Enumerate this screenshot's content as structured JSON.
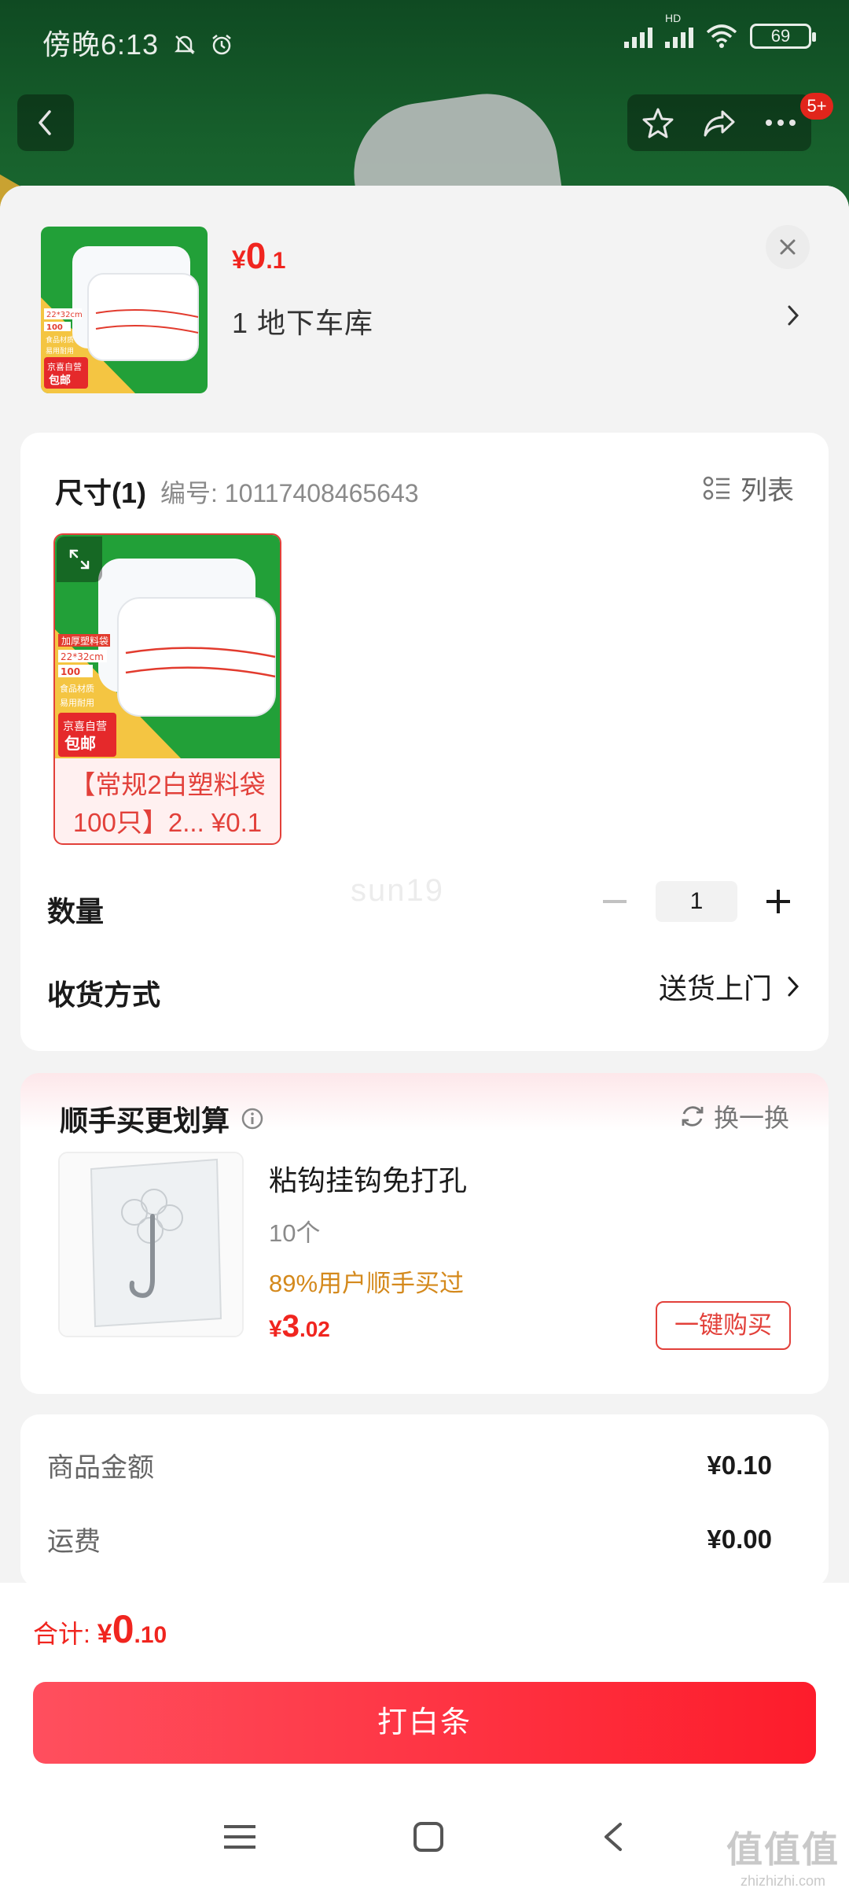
{
  "status_bar": {
    "time": "傍晚6:13",
    "network": "HD",
    "battery": "69"
  },
  "top_nav": {
    "badge": "5+"
  },
  "product": {
    "price_symbol": "¥",
    "price_int": "0",
    "price_dec": ".1",
    "address": "1  地下车库",
    "thumb_tags": {
      "spec": "22*32cm",
      "count": "100",
      "tag1": "食品材质",
      "tag2": "易用耐用",
      "store": "京喜自营",
      "ship": "包邮"
    }
  },
  "spec": {
    "title": "尺寸(1)",
    "code": "编号: 10117408465643",
    "list_label": "列表",
    "option_text": "【常规2白塑料袋100只】2... ¥0.1",
    "option_img": {
      "header": "加厚塑料袋",
      "spec": "22*32cm",
      "count": "100",
      "tag1": "食品材质",
      "tag2": "易用耐用",
      "store": "京喜自营",
      "ship": "包邮"
    }
  },
  "quantity": {
    "label": "数量",
    "value": "1",
    "watermark": "sun19"
  },
  "delivery": {
    "label": "收货方式",
    "value": "送货上门"
  },
  "recommend": {
    "title": "顺手买更划算",
    "swap_label": "换一换",
    "item": {
      "name": "粘钩挂钩免打孔",
      "count": "10个",
      "bought": "89%用户顺手买过",
      "price_symbol": "¥",
      "price_int": "3",
      "price_dec": ".02",
      "buy_label": "一键购买"
    }
  },
  "summary": {
    "goods_label": "商品金额",
    "goods_value": "¥0.10",
    "freight_label": "运费",
    "freight_value": "¥0.00"
  },
  "bottom": {
    "total_label": "合计: ",
    "total_symbol": "¥",
    "total_int": "0",
    "total_dec": ".10",
    "pay_label": "打白条"
  },
  "watermark_site": {
    "line1": "值值值",
    "line2": "zhizhizhi.com"
  },
  "colors": {
    "accent": "#f0251f",
    "orange": "#d4891c",
    "bg": "#f3f3f3"
  }
}
